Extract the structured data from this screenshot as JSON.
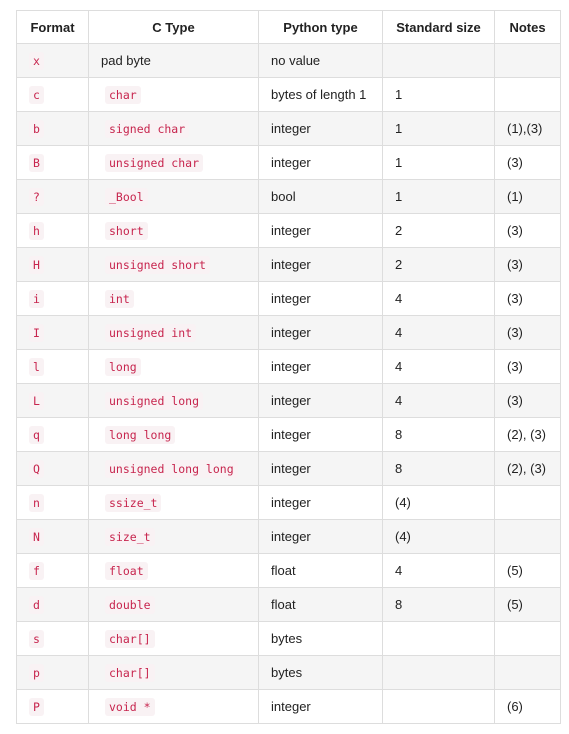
{
  "table": {
    "headers": [
      "Format",
      "C Type",
      "Python type",
      "Standard size",
      "Notes"
    ],
    "rows": [
      {
        "format": "x",
        "ctype": "pad byte",
        "ctype_code": false,
        "python": "no value",
        "size": "",
        "notes": ""
      },
      {
        "format": "c",
        "ctype": "char",
        "ctype_code": true,
        "python": "bytes of length 1",
        "size": "1",
        "notes": ""
      },
      {
        "format": "b",
        "ctype": "signed char",
        "ctype_code": true,
        "python": "integer",
        "size": "1",
        "notes": "(1),(3)"
      },
      {
        "format": "B",
        "ctype": "unsigned char",
        "ctype_code": true,
        "python": "integer",
        "size": "1",
        "notes": "(3)"
      },
      {
        "format": "?",
        "ctype": "_Bool",
        "ctype_code": true,
        "python": "bool",
        "size": "1",
        "notes": "(1)"
      },
      {
        "format": "h",
        "ctype": "short",
        "ctype_code": true,
        "python": "integer",
        "size": "2",
        "notes": "(3)"
      },
      {
        "format": "H",
        "ctype": "unsigned short",
        "ctype_code": true,
        "python": "integer",
        "size": "2",
        "notes": "(3)"
      },
      {
        "format": "i",
        "ctype": "int",
        "ctype_code": true,
        "python": "integer",
        "size": "4",
        "notes": "(3)"
      },
      {
        "format": "I",
        "ctype": "unsigned int",
        "ctype_code": true,
        "python": "integer",
        "size": "4",
        "notes": "(3)"
      },
      {
        "format": "l",
        "ctype": "long",
        "ctype_code": true,
        "python": "integer",
        "size": "4",
        "notes": "(3)"
      },
      {
        "format": "L",
        "ctype": "unsigned long",
        "ctype_code": true,
        "python": "integer",
        "size": "4",
        "notes": "(3)"
      },
      {
        "format": "q",
        "ctype": "long long",
        "ctype_code": true,
        "python": "integer",
        "size": "8",
        "notes": "(2), (3)"
      },
      {
        "format": "Q",
        "ctype": "unsigned long long",
        "ctype_code": true,
        "python": "integer",
        "size": "8",
        "notes": "(2), (3)"
      },
      {
        "format": "n",
        "ctype": "ssize_t",
        "ctype_code": true,
        "python": "integer",
        "size": "(4)",
        "notes": ""
      },
      {
        "format": "N",
        "ctype": "size_t",
        "ctype_code": true,
        "python": "integer",
        "size": "(4)",
        "notes": ""
      },
      {
        "format": "f",
        "ctype": "float",
        "ctype_code": true,
        "python": "float",
        "size": "4",
        "notes": "(5)"
      },
      {
        "format": "d",
        "ctype": "double",
        "ctype_code": true,
        "python": "float",
        "size": "8",
        "notes": "(5)"
      },
      {
        "format": "s",
        "ctype": "char[]",
        "ctype_code": true,
        "python": "bytes",
        "size": "",
        "notes": ""
      },
      {
        "format": "p",
        "ctype": "char[]",
        "ctype_code": true,
        "python": "bytes",
        "size": "",
        "notes": ""
      },
      {
        "format": "P",
        "ctype": "void *",
        "ctype_code": true,
        "python": "integer",
        "size": "",
        "notes": "(6)"
      }
    ]
  },
  "colors": {
    "code_text": "#c7254e",
    "code_bg": "#f9f2f4",
    "row_stripe": "#f5f5f5",
    "border": "#dddddd"
  }
}
